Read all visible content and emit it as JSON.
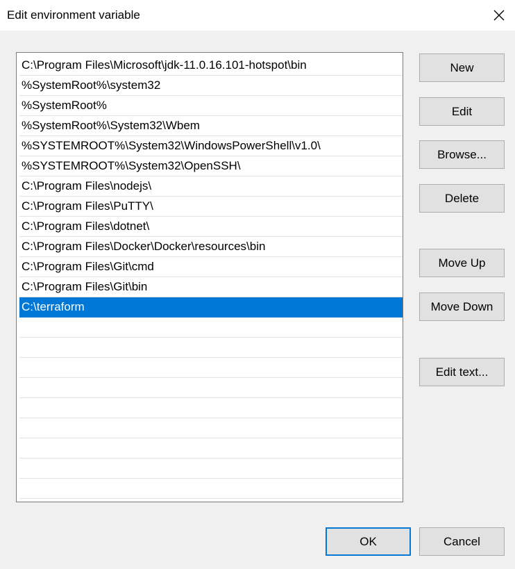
{
  "window": {
    "title": "Edit environment variable",
    "close_icon": "close-icon"
  },
  "list": {
    "items": [
      "C:\\Program Files\\Microsoft\\jdk-11.0.16.101-hotspot\\bin",
      "%SystemRoot%\\system32",
      "%SystemRoot%",
      "%SystemRoot%\\System32\\Wbem",
      "%SYSTEMROOT%\\System32\\WindowsPowerShell\\v1.0\\",
      "%SYSTEMROOT%\\System32\\OpenSSH\\",
      "C:\\Program Files\\nodejs\\",
      "C:\\Program Files\\PuTTY\\",
      "C:\\Program Files\\dotnet\\",
      "C:\\Program Files\\Docker\\Docker\\resources\\bin",
      "C:\\Program Files\\Git\\cmd",
      "C:\\Program Files\\Git\\bin",
      "C:\\terraform"
    ],
    "selected_index": 12,
    "empty_rows": 9
  },
  "buttons": {
    "new": "New",
    "edit": "Edit",
    "browse": "Browse...",
    "delete": "Delete",
    "move_up": "Move Up",
    "move_down": "Move Down",
    "edit_text": "Edit text...",
    "ok": "OK",
    "cancel": "Cancel"
  },
  "colors": {
    "selection": "#0078d7",
    "dialog_background": "#f0f0f0",
    "button_face": "#e1e1e1"
  }
}
